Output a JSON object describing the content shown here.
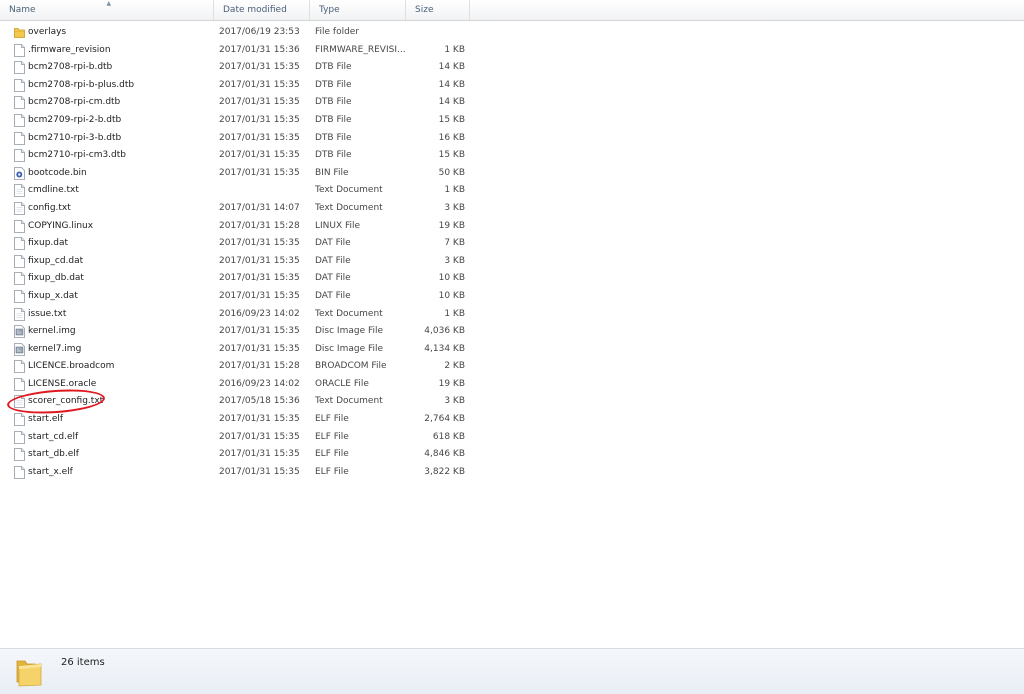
{
  "columns": {
    "name": "Name",
    "date": "Date modified",
    "type": "Type",
    "size": "Size"
  },
  "files": [
    {
      "name": "overlays",
      "date": "2017/06/19 23:53",
      "type": "File folder",
      "size": "",
      "icon": "folder-icon"
    },
    {
      "name": ".firmware_revision",
      "date": "2017/01/31 15:36",
      "type": "FIRMWARE_REVISI...",
      "size": "1 KB",
      "icon": "file-icon"
    },
    {
      "name": "bcm2708-rpi-b.dtb",
      "date": "2017/01/31 15:35",
      "type": "DTB File",
      "size": "14 KB",
      "icon": "file-icon"
    },
    {
      "name": "bcm2708-rpi-b-plus.dtb",
      "date": "2017/01/31 15:35",
      "type": "DTB File",
      "size": "14 KB",
      "icon": "file-icon"
    },
    {
      "name": "bcm2708-rpi-cm.dtb",
      "date": "2017/01/31 15:35",
      "type": "DTB File",
      "size": "14 KB",
      "icon": "file-icon"
    },
    {
      "name": "bcm2709-rpi-2-b.dtb",
      "date": "2017/01/31 15:35",
      "type": "DTB File",
      "size": "15 KB",
      "icon": "file-icon"
    },
    {
      "name": "bcm2710-rpi-3-b.dtb",
      "date": "2017/01/31 15:35",
      "type": "DTB File",
      "size": "16 KB",
      "icon": "file-icon"
    },
    {
      "name": "bcm2710-rpi-cm3.dtb",
      "date": "2017/01/31 15:35",
      "type": "DTB File",
      "size": "15 KB",
      "icon": "file-icon"
    },
    {
      "name": "bootcode.bin",
      "date": "2017/01/31 15:35",
      "type": "BIN File",
      "size": "50 KB",
      "icon": "bin-file-icon"
    },
    {
      "name": "cmdline.txt",
      "date": "",
      "type": "Text Document",
      "size": "1 KB",
      "icon": "text-file-icon"
    },
    {
      "name": "config.txt",
      "date": "2017/01/31 14:07",
      "type": "Text Document",
      "size": "3 KB",
      "icon": "text-file-icon"
    },
    {
      "name": "COPYING.linux",
      "date": "2017/01/31 15:28",
      "type": "LINUX File",
      "size": "19 KB",
      "icon": "file-icon"
    },
    {
      "name": "fixup.dat",
      "date": "2017/01/31 15:35",
      "type": "DAT File",
      "size": "7 KB",
      "icon": "file-icon"
    },
    {
      "name": "fixup_cd.dat",
      "date": "2017/01/31 15:35",
      "type": "DAT File",
      "size": "3 KB",
      "icon": "file-icon"
    },
    {
      "name": "fixup_db.dat",
      "date": "2017/01/31 15:35",
      "type": "DAT File",
      "size": "10 KB",
      "icon": "file-icon"
    },
    {
      "name": "fixup_x.dat",
      "date": "2017/01/31 15:35",
      "type": "DAT File",
      "size": "10 KB",
      "icon": "file-icon"
    },
    {
      "name": "issue.txt",
      "date": "2016/09/23 14:02",
      "type": "Text Document",
      "size": "1 KB",
      "icon": "text-file-icon"
    },
    {
      "name": "kernel.img",
      "date": "2017/01/31 15:35",
      "type": "Disc Image File",
      "size": "4,036 KB",
      "icon": "disc-image-icon"
    },
    {
      "name": "kernel7.img",
      "date": "2017/01/31 15:35",
      "type": "Disc Image File",
      "size": "4,134 KB",
      "icon": "disc-image-icon"
    },
    {
      "name": "LICENCE.broadcom",
      "date": "2017/01/31 15:28",
      "type": "BROADCOM File",
      "size": "2 KB",
      "icon": "file-icon"
    },
    {
      "name": "LICENSE.oracle",
      "date": "2016/09/23 14:02",
      "type": "ORACLE File",
      "size": "19 KB",
      "icon": "file-icon"
    },
    {
      "name": "scorer_config.txt",
      "date": "2017/05/18 15:36",
      "type": "Text Document",
      "size": "3 KB",
      "icon": "text-file-icon"
    },
    {
      "name": "start.elf",
      "date": "2017/01/31 15:35",
      "type": "ELF File",
      "size": "2,764 KB",
      "icon": "file-icon"
    },
    {
      "name": "start_cd.elf",
      "date": "2017/01/31 15:35",
      "type": "ELF File",
      "size": "618 KB",
      "icon": "file-icon"
    },
    {
      "name": "start_db.elf",
      "date": "2017/01/31 15:35",
      "type": "ELF File",
      "size": "4,846 KB",
      "icon": "file-icon"
    },
    {
      "name": "start_x.elf",
      "date": "2017/01/31 15:35",
      "type": "ELF File",
      "size": "3,822 KB",
      "icon": "file-icon"
    }
  ],
  "status": {
    "item_count": "26 items",
    "icon": "folder-icon"
  },
  "colors": {
    "highlight_ellipse": "#e0171e",
    "folder": "#f2c94c",
    "header_text": "#4c607a"
  }
}
